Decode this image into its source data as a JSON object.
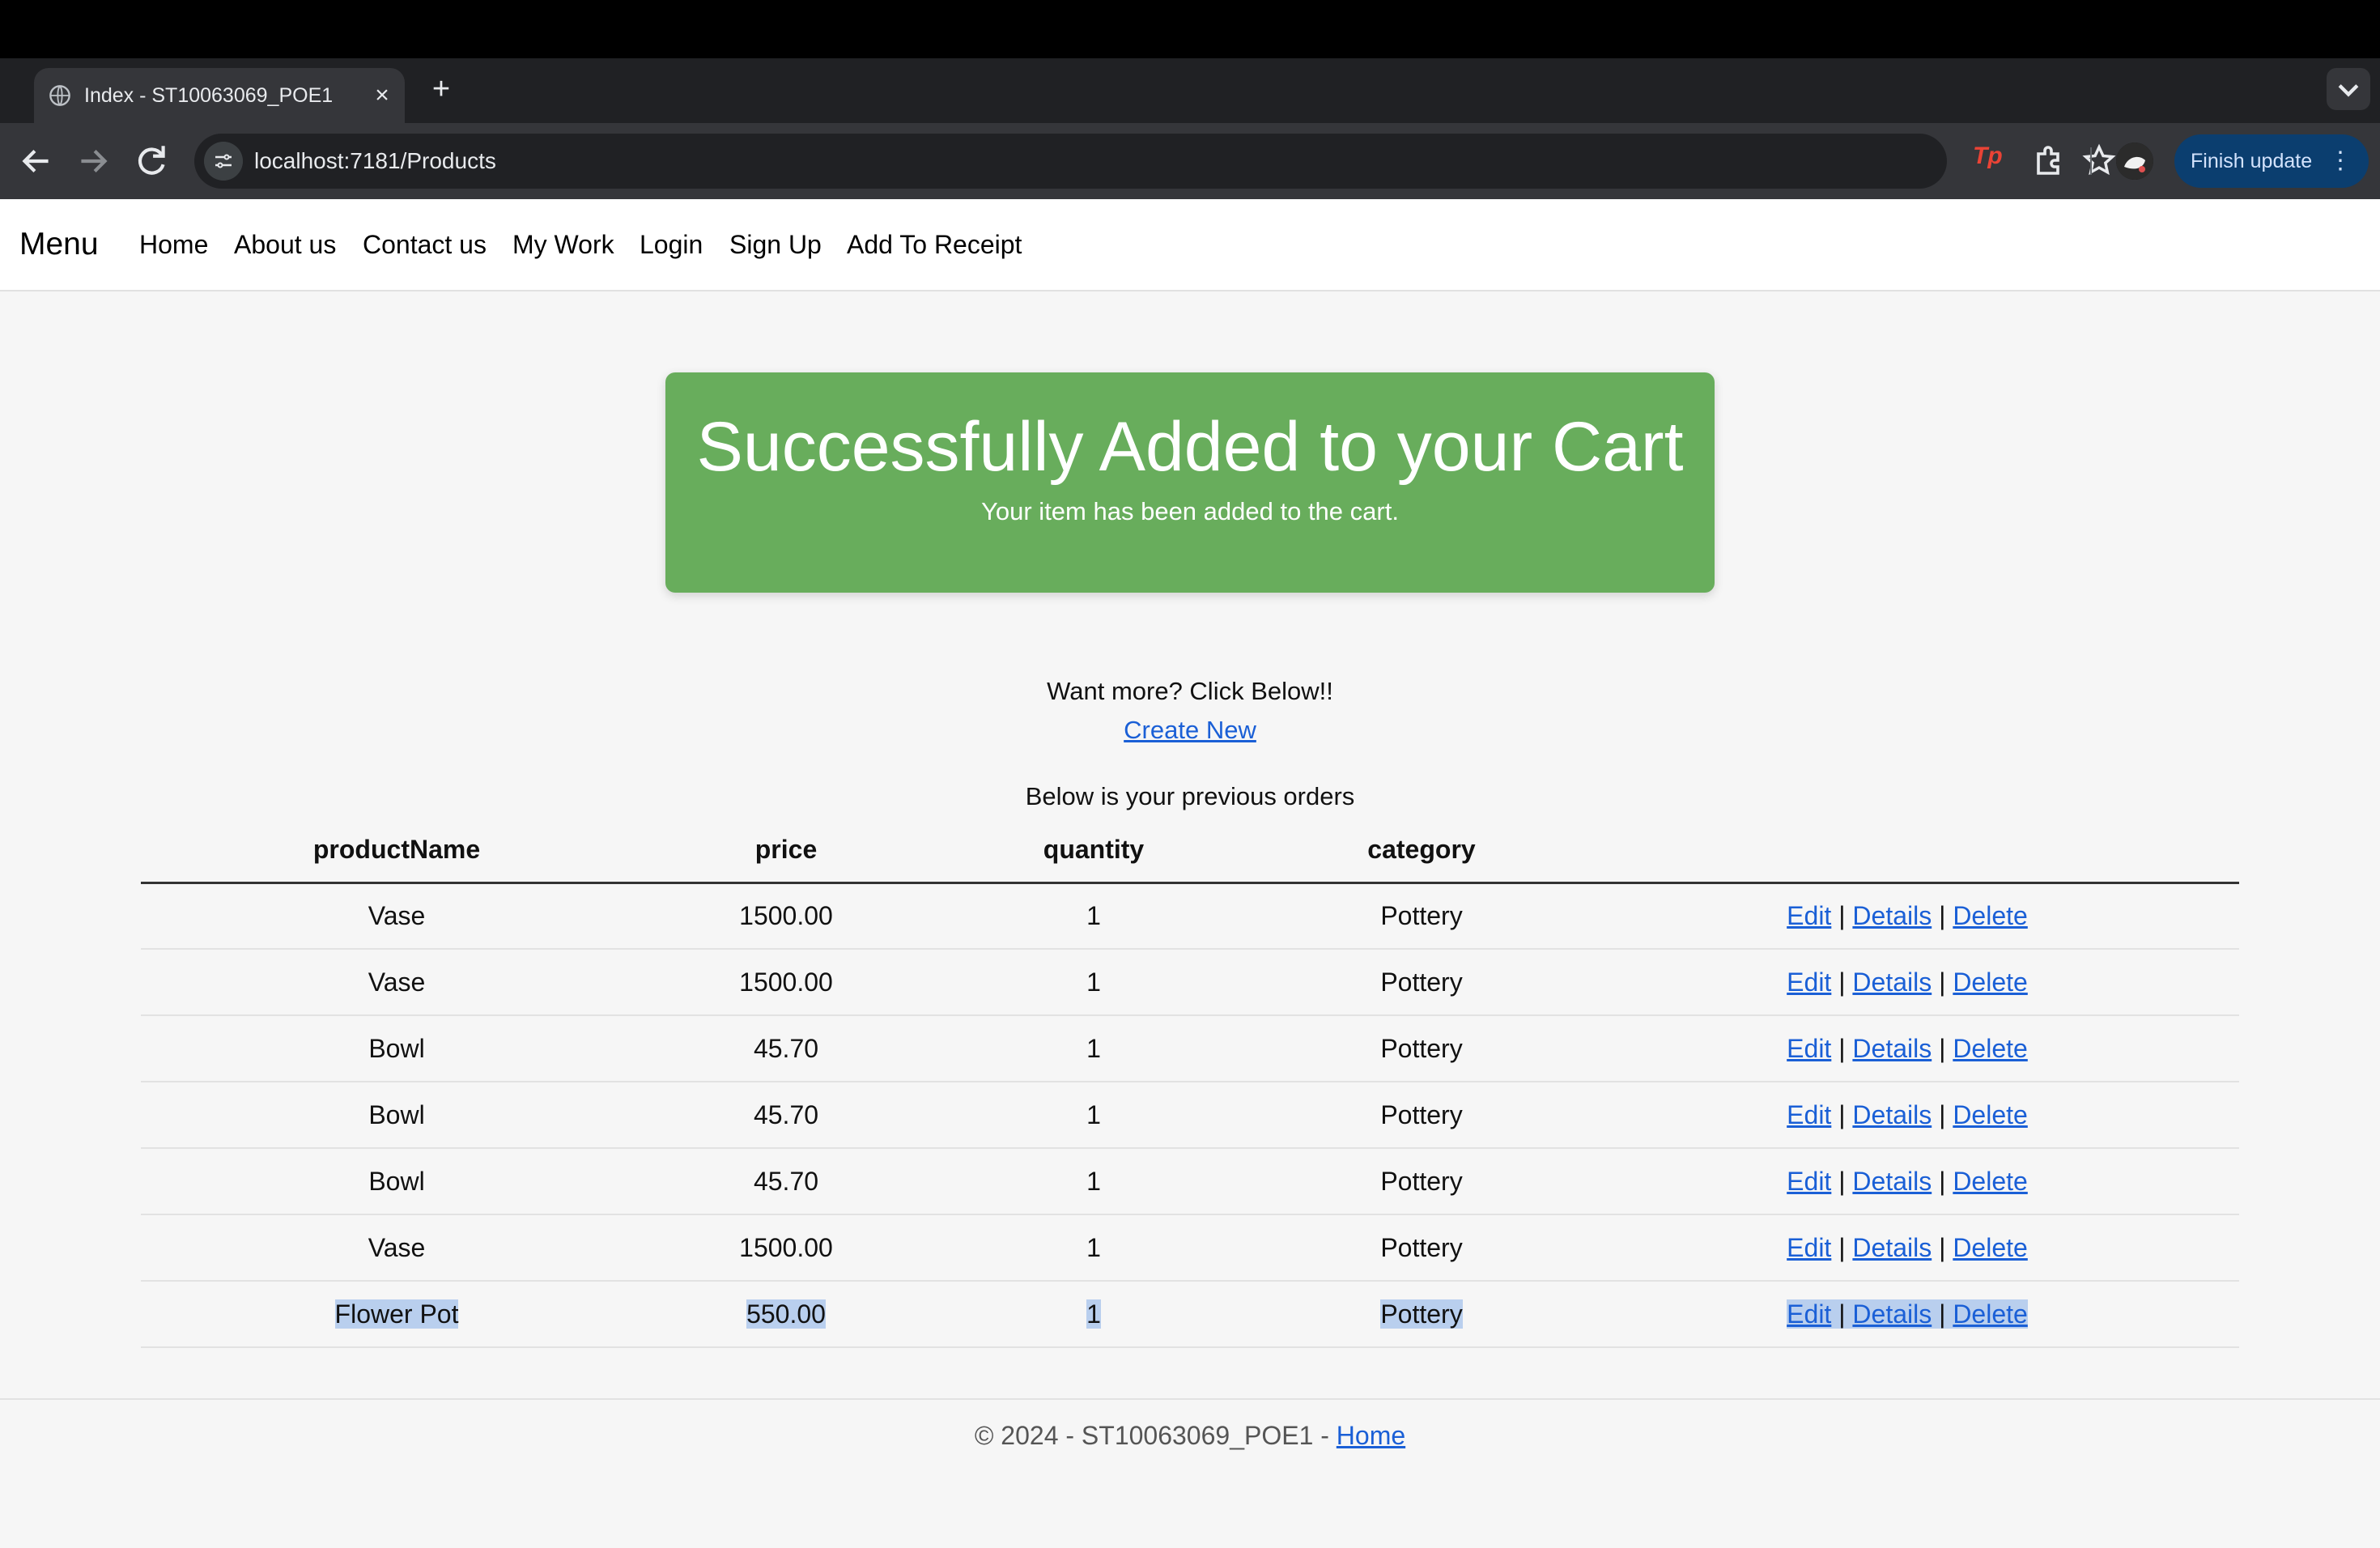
{
  "browser": {
    "tab_title": "Index - ST10063069_POE1",
    "tab_close": "×",
    "new_tab": "+",
    "url": "localhost:7181/Products",
    "extension_label": "Tp",
    "finish_update": "Finish update",
    "finish_menu": "⋮"
  },
  "nav": {
    "brand": "Menu",
    "links": [
      "Home",
      "About us",
      "Contact us",
      "My Work",
      "Login",
      "Sign Up",
      "Add To Receipt"
    ]
  },
  "alert": {
    "title": "Successfully Added to your Cart",
    "message": "Your item has been added to the cart."
  },
  "promo": {
    "text": "Want more? Click Below!!",
    "create_link": "Create New"
  },
  "orders": {
    "caption": "Below is your previous orders",
    "headers": [
      "productName",
      "price",
      "quantity",
      "category"
    ],
    "actions": {
      "edit": "Edit",
      "details": "Details",
      "delete": "Delete",
      "separator": "|"
    },
    "rows": [
      {
        "productName": "Vase",
        "price": "1500.00",
        "quantity": "1",
        "category": "Pottery"
      },
      {
        "productName": "Vase",
        "price": "1500.00",
        "quantity": "1",
        "category": "Pottery"
      },
      {
        "productName": "Bowl",
        "price": "45.70",
        "quantity": "1",
        "category": "Pottery"
      },
      {
        "productName": "Bowl",
        "price": "45.70",
        "quantity": "1",
        "category": "Pottery"
      },
      {
        "productName": "Bowl",
        "price": "45.70",
        "quantity": "1",
        "category": "Pottery"
      },
      {
        "productName": "Vase",
        "price": "1500.00",
        "quantity": "1",
        "category": "Pottery"
      },
      {
        "productName": "Flower Pot",
        "price": "550.00",
        "quantity": "1",
        "category": "Pottery"
      }
    ]
  },
  "footer": {
    "text": "© 2024 - ST10063069_POE1 - ",
    "home_link": "Home"
  }
}
